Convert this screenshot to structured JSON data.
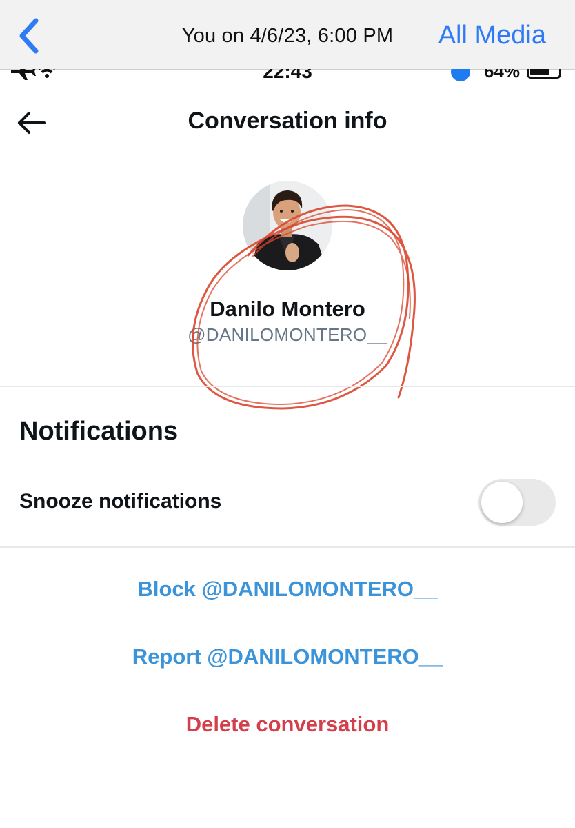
{
  "viewer": {
    "back_icon": "chevron-left-icon",
    "title": "You on 4/6/23, 6:00 PM",
    "all_media_label": "All Media",
    "accent_color": "#2f7bf6"
  },
  "status_bar": {
    "time": "22:43",
    "battery_percent": "64%",
    "icons": [
      "airplane-icon",
      "wifi-icon",
      "location-icon",
      "battery-icon"
    ]
  },
  "conversation": {
    "back_icon": "arrow-left-icon",
    "title": "Conversation info"
  },
  "profile": {
    "display_name": "Danilo Montero",
    "handle": "@DANILOMONTERO__"
  },
  "notifications": {
    "heading": "Notifications",
    "snooze_label": "Snooze notifications",
    "snooze_enabled": false
  },
  "actions": {
    "block_label": "Block @DANILOMONTERO__",
    "report_label": "Report @DANILOMONTERO__",
    "delete_label": "Delete conversation",
    "link_color": "#3b94d9",
    "danger_color": "#d33f4b"
  },
  "annotation": {
    "color": "#d9462d"
  }
}
